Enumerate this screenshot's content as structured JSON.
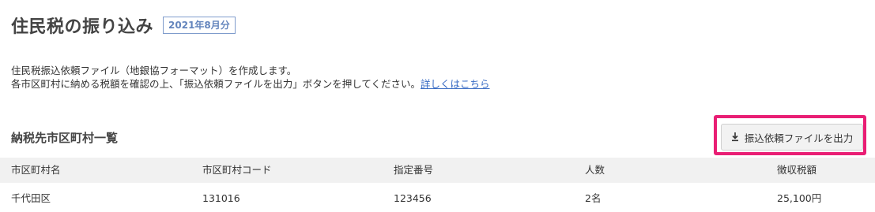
{
  "header": {
    "title": "住民税の振り込み",
    "period_badge": "2021年8月分"
  },
  "description": {
    "line1": "住民税振込依頼ファイル（地銀協フォーマット）を作成します。",
    "line2": "各市区町村に納める税額を確認の上、「振込依頼ファイルを出力」ボタンを押してください。",
    "link_text": "詳しくはこちら"
  },
  "section": {
    "title": "納税先市区町村一覧",
    "export_button_label": "振込依頼ファイルを出力",
    "export_button_icon": "download-icon"
  },
  "colors": {
    "highlight": "#e91e74",
    "badge": "#6485bd",
    "link": "#3a6cc4"
  },
  "table": {
    "columns": [
      "市区町村名",
      "市区町村コード",
      "指定番号",
      "人数",
      "徴収税額"
    ],
    "rows": [
      [
        "千代田区",
        "131016",
        "123456",
        "2名",
        "25,100円"
      ]
    ]
  }
}
